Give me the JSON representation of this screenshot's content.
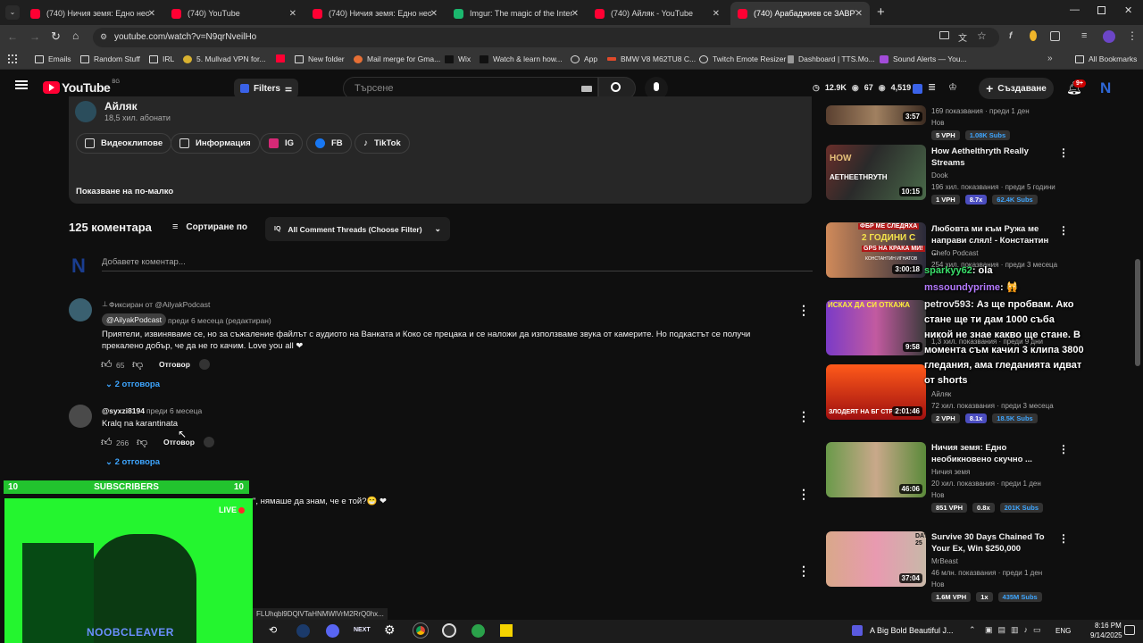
{
  "browser": {
    "tabs": [
      {
        "title": "(740) Ничия земя: Едно необи",
        "icon": "youtube-icon"
      },
      {
        "title": "(740) YouTube",
        "icon": "youtube-icon"
      },
      {
        "title": "(740) Ничия земя: Едно необи",
        "icon": "youtube-icon"
      },
      {
        "title": "Imgur: The magic of the Interne",
        "icon": "imgur-icon"
      },
      {
        "title": "(740) Айляк - YouTube",
        "icon": "youtube-icon"
      },
      {
        "title": "(740) Арабаджиев се ЗАВРЪЩ",
        "icon": "youtube-icon"
      }
    ],
    "url": "youtube.com/watch?v=N9qrNveilHo",
    "bookmarks": [
      "Emails",
      "Random Stuff",
      "IRL",
      "5. Mullvad VPN for...",
      "New folder",
      "Mail merge for Gma...",
      "Wix",
      "Watch & learn how...",
      "App",
      "BMW V8 M62TU8 C...",
      "Twitch Emote Resizer",
      "Dashboard | TTS.Mo...",
      "Sound Alerts — You..."
    ],
    "all_bookmarks": "All Bookmarks"
  },
  "header": {
    "logo": "YouTube",
    "region": "BG",
    "filters": "Filters",
    "search_placeholder": "Търсене",
    "stats": {
      "views": "12.9K",
      "watching": "67",
      "other": "4,519"
    },
    "create": "Създаване",
    "notif_count": "9+",
    "avatar_letter": "N"
  },
  "channel": {
    "name": "Айляк",
    "subs": "18,5 хил. абонати",
    "links": [
      "Видеоклипове",
      "Информация",
      "IG",
      "FB",
      "TikTok"
    ],
    "show_less": "Показване на по-малко"
  },
  "comments": {
    "count": "125 коментара",
    "sort": "Сортиране по",
    "filter": "All Comment Threads (Choose Filter)",
    "add_placeholder": "Добавете коментар...",
    "user_letter": "N",
    "items": [
      {
        "pinned": "Фиксиран от @AilyakPodcast",
        "author": "@AilyakPodcast",
        "time": "преди 6 месеца (редактиран)",
        "text1": "Приятели, извиняваме се, но за съжаление файлът с аудиото на Ванката и Коко се прецака и се наложи да използваме звука от камерите. Но подкастът се получи",
        "text2": "прекалено добър, че да не го качим. Love you all ❤",
        "likes": "65",
        "reply": "Отговор",
        "replies": "2 отговора"
      },
      {
        "author": "@syxzi8194",
        "time": "преди 6 месеца",
        "text1": "Kralq na karantinata",
        "likes": "266",
        "reply": "Отговор",
        "replies": "2 отговора"
      },
      {
        "text1": "\", нямаше да знам, че е той?😁 ❤"
      }
    ]
  },
  "sidebar": [
    {
      "title": "",
      "channel": "",
      "meta": "169 показвания · преди 1 ден",
      "badge": "Нов",
      "dur": "3:57",
      "vph": "5 VPH",
      "mult": "",
      "subs": "1.08K Subs"
    },
    {
      "title": "How Aethelthryth Really Streams",
      "channel": "Dook",
      "meta": "196 хил. показвания · преди 5 години",
      "badge": "",
      "dur": "10:15",
      "vph": "1 VPH",
      "mult": "8.7x",
      "subs": "62.4K Subs"
    },
    {
      "title": "Любовта ми към Ружа ме направи слял! - Константин ...",
      "channel": "Chefo Podcast",
      "meta": "254 хил. показвания · преди 3 месеца",
      "badge": "",
      "dur": "3:00:18",
      "vph": "",
      "mult": "",
      "subs": ""
    },
    {
      "title": "",
      "channel": "",
      "meta": "1,3 хил. показвания · преди 9 дни",
      "badge": "",
      "dur": "9:58",
      "vph": "",
      "mult": "",
      "subs": ""
    },
    {
      "title": "",
      "channel": "Айляк",
      "meta": "72 хил. показвания · преди 3 месеца",
      "badge": "",
      "dur": "2:01:46",
      "vph": "2 VPH",
      "mult": "8.1x",
      "subs": "18.5K Subs"
    },
    {
      "title": "Ничия земя: Едно необикновено скучно ...",
      "channel": "Ничия земя",
      "meta": "20 хил. показвания · преди 1 ден",
      "badge": "Нов",
      "dur": "46:06",
      "vph": "851 VPH",
      "mult": "0.8x",
      "subs": "201K Subs"
    },
    {
      "title": "Survive 30 Days Chained To Your Ex, Win $250,000",
      "channel": "MrBeast",
      "meta": "46 млн. показвания · преди 1 ден",
      "badge": "Нов",
      "dur": "37:04",
      "vph": "1.6M VPH",
      "mult": "1x",
      "subs": "435M Subs"
    }
  ],
  "thumb_texts": {
    "t2a": "HOW",
    "t2b": "АЕТНЕЕТНRУТН",
    "t3a": "ФБР МЕ СЛЕДЯХА",
    "t3b": "2 ГОДИНИ С",
    "t3c": "GPS НА КРАКА МИ!",
    "t3d": "КОНСТАНТИН ИГНАТОВ",
    "t4": "ИСКАХ ДА СИ ОТКАЖА",
    "t5": "ЗЛОДЕЯТ НА БГ СТРИ",
    "t7": "DAY 25"
  },
  "chat": [
    {
      "user": "sparkyy62",
      "text": ": ola"
    },
    {
      "user": "mssoundyprime",
      "text": ": 🙀"
    },
    {
      "user": "petrov593",
      "text": ": Аз ще пробвам. Ако стане ще ти дам 1000 съба никой не знае какво ще стане. В момента съм качил 3 клипа 3800 гледания, ама гледанията идват от shorts"
    }
  ],
  "overlay": {
    "subs_count_left": "10",
    "subs_label": "SUBSCRIBERS",
    "subs_count_right": "10",
    "live": "LIVE",
    "streamer": "NOOBCLEAVER"
  },
  "statusbar_link": "FLUhqbl9DQlVTaHNMWlVrM2RrQ0hx...",
  "taskbar": {
    "media": "A Big Bold Beautiful J...",
    "lang": "ENG",
    "time": "8:16 PM",
    "date": "9/14/2025"
  }
}
